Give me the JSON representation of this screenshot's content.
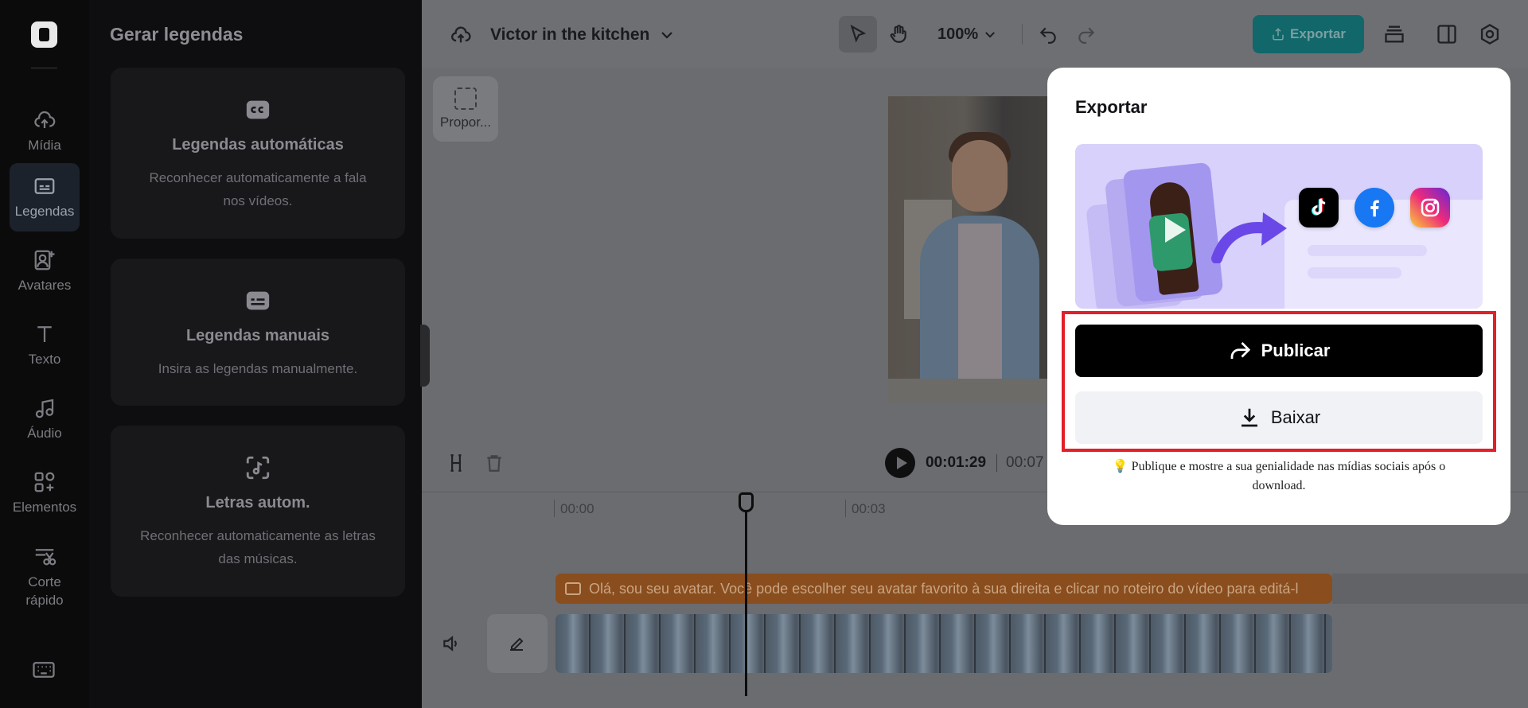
{
  "rail": {
    "items": [
      {
        "label": "Mídia",
        "icon": "cloud-upload-icon"
      },
      {
        "label": "Legendas",
        "icon": "captions-icon",
        "active": true
      },
      {
        "label": "Avatares",
        "icon": "avatar-icon"
      },
      {
        "label": "Texto",
        "icon": "text-icon"
      },
      {
        "label": "Áudio",
        "icon": "music-icon"
      },
      {
        "label": "Elementos",
        "icon": "elements-icon"
      },
      {
        "label": "Corte rápido",
        "icon": "quick-cut-icon"
      }
    ]
  },
  "panel": {
    "title": "Gerar legendas",
    "cards": [
      {
        "title": "Legendas automáticas",
        "desc": "Reconhecer automaticamente a fala nos vídeos."
      },
      {
        "title": "Legendas manuais",
        "desc": "Insira as legendas manualmente."
      },
      {
        "title": "Letras autom.",
        "desc": "Reconhecer automaticamente as letras das músicas."
      }
    ]
  },
  "topbar": {
    "project_name": "Victor in the kitchen",
    "zoom": "100%",
    "export_label": "Exportar"
  },
  "canvas": {
    "ratio_label": "Propor..."
  },
  "timeline": {
    "current_time": "00:01:29",
    "total_time": "00:07",
    "ruler": [
      "00:00",
      "00:03"
    ],
    "caption_text": "Olá, sou seu avatar. Você pode escolher seu avatar favorito à sua direita e clicar no roteiro do vídeo para editá-l"
  },
  "export_modal": {
    "title": "Exportar",
    "publish_label": "Publicar",
    "download_label": "Baixar",
    "hint": "Publique e mostre a sua genialidade nas mídias sociais após o download.",
    "hint_icon": "💡",
    "social_icons": [
      "tiktok-icon",
      "facebook-icon",
      "instagram-icon"
    ]
  },
  "colors": {
    "accent_export": "#11676a",
    "caption_track": "#8a4d1e",
    "highlight_outline": "#e3202a",
    "hero_bg": "#d7d1fb"
  }
}
